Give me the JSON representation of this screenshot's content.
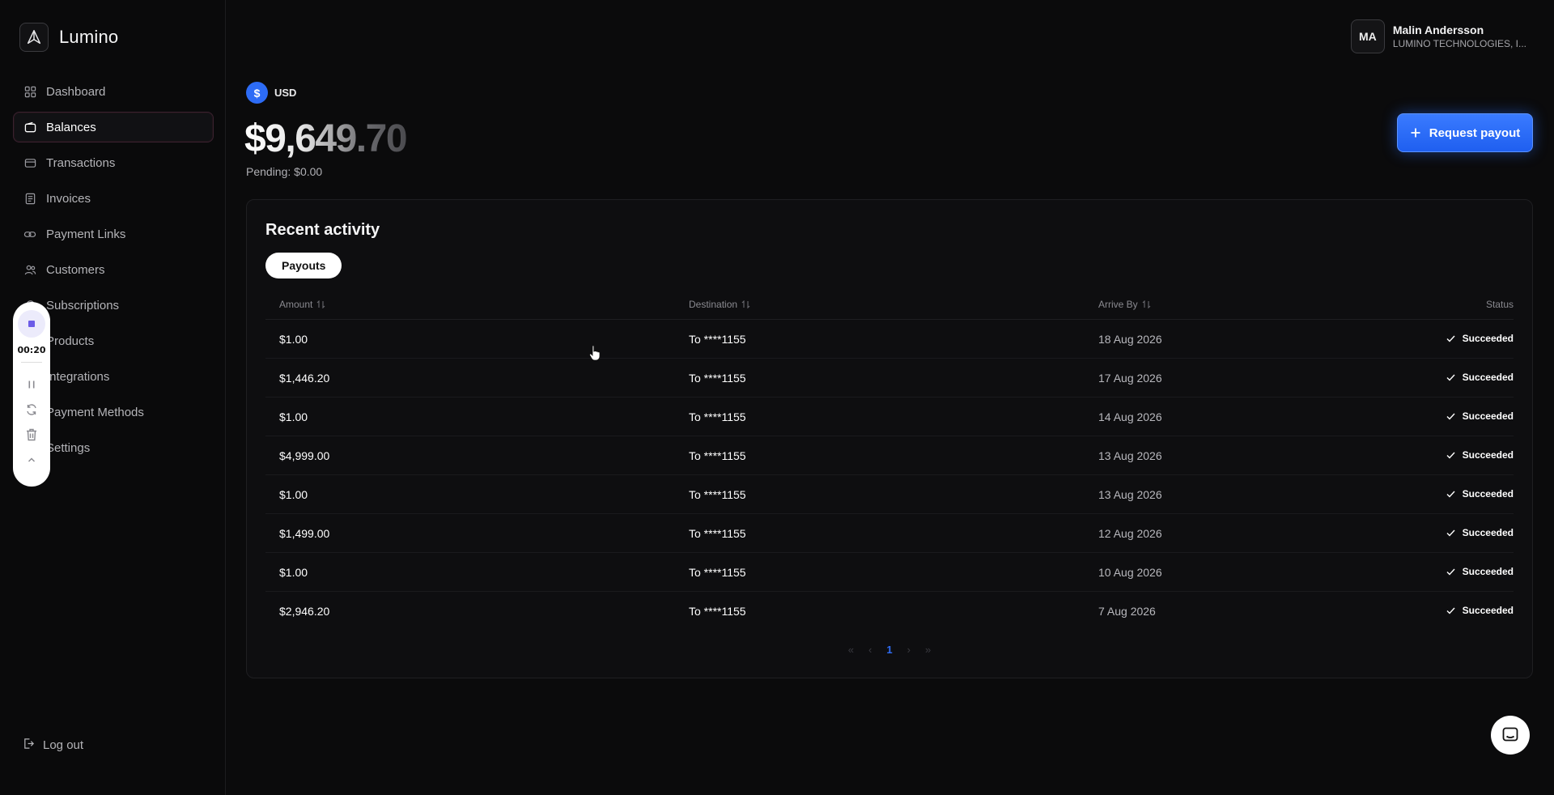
{
  "app": {
    "name": "Lumino"
  },
  "sidebar": {
    "items": [
      {
        "label": "Dashboard",
        "icon": "grid-icon"
      },
      {
        "label": "Balances",
        "icon": "wallet-icon",
        "active": true
      },
      {
        "label": "Transactions",
        "icon": "transactions-icon"
      },
      {
        "label": "Invoices",
        "icon": "invoice-icon"
      },
      {
        "label": "Payment Links",
        "icon": "link-icon"
      },
      {
        "label": "Customers",
        "icon": "users-icon"
      },
      {
        "label": "Subscriptions",
        "icon": "refresh-icon"
      },
      {
        "label": "Products",
        "icon": "box-icon"
      },
      {
        "label": "Integrations",
        "icon": "plug-icon"
      },
      {
        "label": "Payment Methods",
        "icon": "card-icon"
      },
      {
        "label": "Settings",
        "icon": "gear-icon"
      }
    ],
    "logout_label": "Log out"
  },
  "recorder": {
    "time": "00:20"
  },
  "user": {
    "initials": "MA",
    "name": "Malin Andersson",
    "org": "LUMINO TECHNOLOGIES, I..."
  },
  "balance": {
    "currency": "USD",
    "amount": "$9,649.70",
    "pending": "Pending: $0.00"
  },
  "actions": {
    "request_payout": "Request payout"
  },
  "activity": {
    "title": "Recent activity",
    "tab": "Payouts",
    "columns": {
      "amount": "Amount",
      "destination": "Destination",
      "arrive_by": "Arrive By",
      "status": "Status"
    },
    "rows": [
      {
        "amount": "$1.00",
        "destination": "To ****1155",
        "arrive_by": "18 Aug 2026",
        "status": "Succeeded"
      },
      {
        "amount": "$1,446.20",
        "destination": "To ****1155",
        "arrive_by": "17 Aug 2026",
        "status": "Succeeded"
      },
      {
        "amount": "$1.00",
        "destination": "To ****1155",
        "arrive_by": "14 Aug 2026",
        "status": "Succeeded"
      },
      {
        "amount": "$4,999.00",
        "destination": "To ****1155",
        "arrive_by": "13 Aug 2026",
        "status": "Succeeded"
      },
      {
        "amount": "$1.00",
        "destination": "To ****1155",
        "arrive_by": "13 Aug 2026",
        "status": "Succeeded"
      },
      {
        "amount": "$1,499.00",
        "destination": "To ****1155",
        "arrive_by": "12 Aug 2026",
        "status": "Succeeded"
      },
      {
        "amount": "$1.00",
        "destination": "To ****1155",
        "arrive_by": "10 Aug 2026",
        "status": "Succeeded"
      },
      {
        "amount": "$2,946.20",
        "destination": "To ****1155",
        "arrive_by": "7 Aug 2026",
        "status": "Succeeded"
      }
    ],
    "pagination": {
      "current_page": "1",
      "first": "«",
      "prev": "‹",
      "next": "›",
      "last": "»"
    }
  },
  "colors": {
    "accent": "#2f6df6",
    "background": "#0b0b0c",
    "card": "#0e0e10"
  }
}
